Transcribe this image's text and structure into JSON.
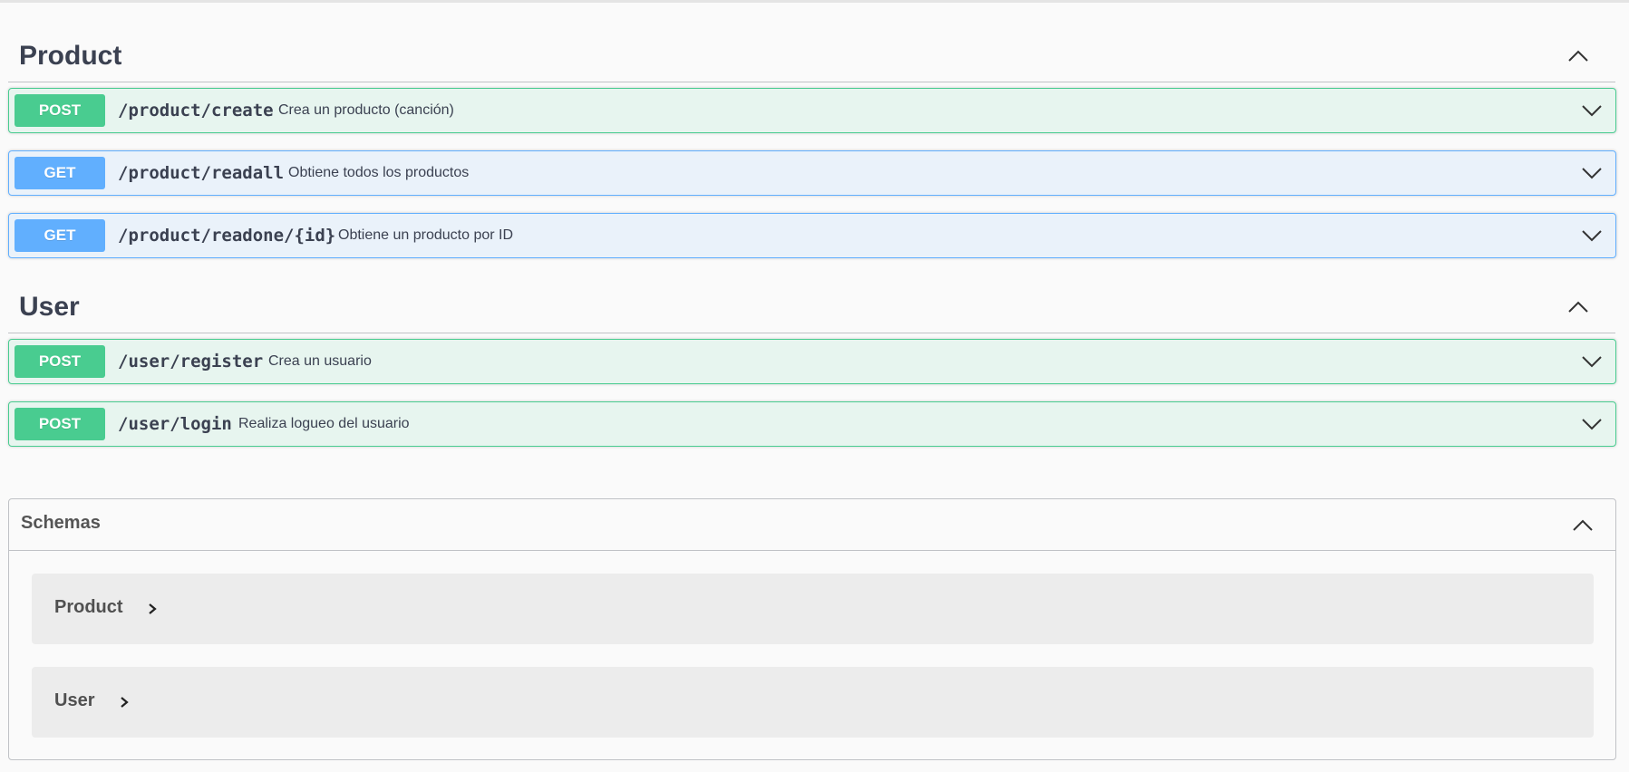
{
  "sections": [
    {
      "title": "Product",
      "operations": [
        {
          "method": "POST",
          "path": "/product/create",
          "summary": "Crea un producto (canción)"
        },
        {
          "method": "GET",
          "path": "/product/readall",
          "summary": "Obtiene todos los productos"
        },
        {
          "method": "GET",
          "path": "/product/readone/{id}",
          "summary": "Obtiene un producto por ID"
        }
      ]
    },
    {
      "title": "User",
      "operations": [
        {
          "method": "POST",
          "path": "/user/register",
          "summary": "Crea un usuario"
        },
        {
          "method": "POST",
          "path": "/user/login",
          "summary": "Realiza logueo del usuario"
        }
      ]
    }
  ],
  "schemas": {
    "title": "Schemas",
    "models": [
      "Product",
      "User"
    ]
  },
  "colors": {
    "post": "#49cc90",
    "get": "#61affe",
    "text": "#3b4151"
  },
  "icons": {
    "section_toggle": "chevron-up-icon",
    "operation_toggle": "chevron-down-icon",
    "model_toggle": "chevron-right-icon"
  }
}
